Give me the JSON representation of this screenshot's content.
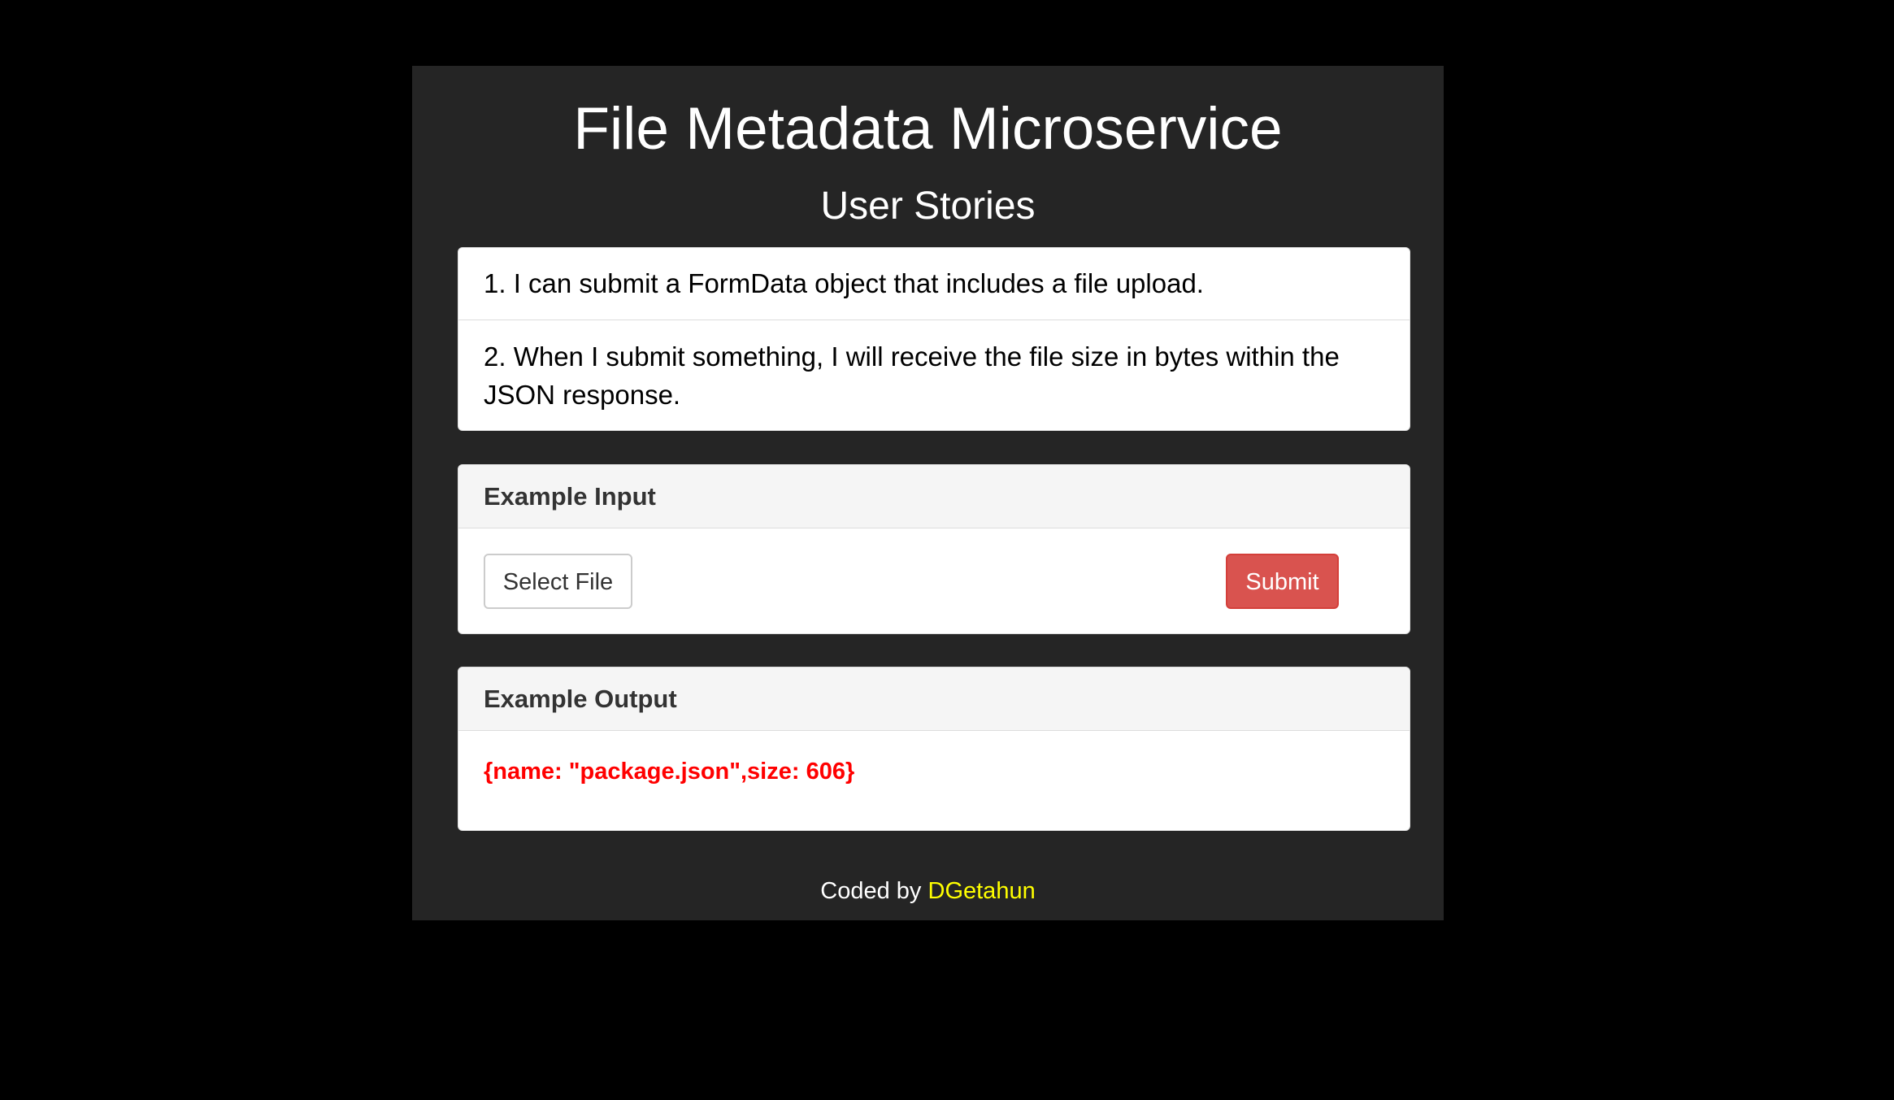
{
  "header": {
    "title": "File Metadata Microservice",
    "subtitle": "User Stories"
  },
  "user_stories": [
    "1. I can submit a FormData object that includes a file upload.",
    "2. When I submit something, I will receive the file size in bytes within the JSON response."
  ],
  "example_input": {
    "heading": "Example Input",
    "select_file_label": "Select File",
    "submit_label": "Submit"
  },
  "example_output": {
    "heading": "Example Output",
    "code": "{name: \"package.json\",size: 606}"
  },
  "footer": {
    "prefix": "Coded by",
    "author": "DGetahun"
  },
  "colors": {
    "background": "#000000",
    "container": "#252525",
    "submit_button": "#d9534f",
    "output_text": "#ff0000",
    "author_link": "#ffff00"
  }
}
